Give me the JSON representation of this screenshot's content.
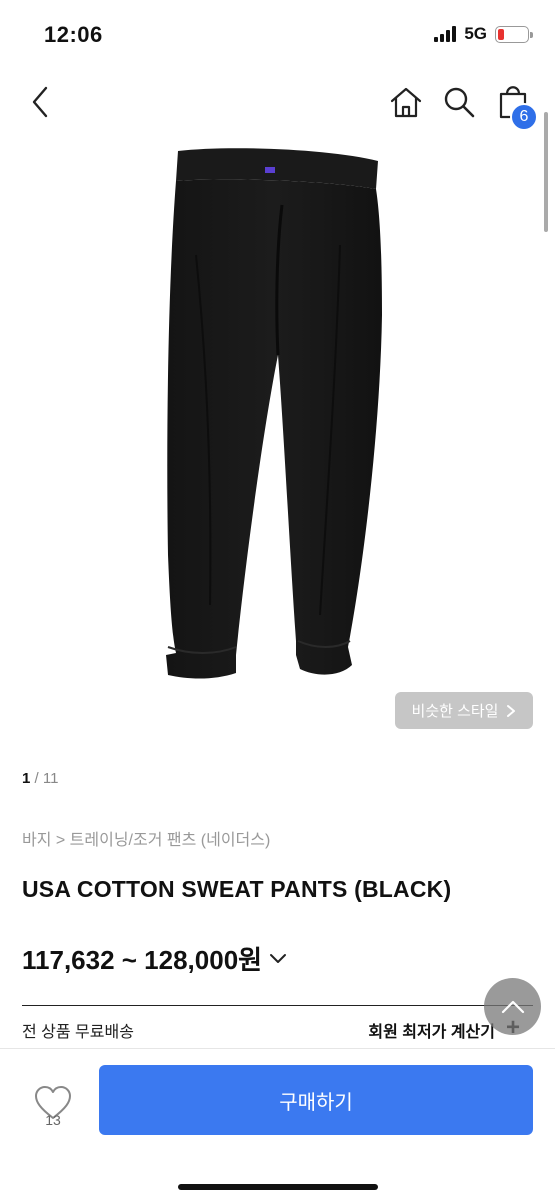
{
  "status": {
    "time": "12:06",
    "network": "5G"
  },
  "header": {
    "cart_count": "6"
  },
  "similar_style": {
    "label": "비슷한 스타일"
  },
  "pager": {
    "current": "1",
    "separator": " / ",
    "total": "11"
  },
  "breadcrumb": "바지 > 트레이닝/조거 팬츠 (네이더스)",
  "product": {
    "title": "USA COTTON SWEAT PANTS (BLACK)",
    "price_range": "117,632 ~ 128,000원"
  },
  "shipping": {
    "free_label": "전 상품 무료배송",
    "calc_label": "회원 최저가 계산기",
    "calc_icon": "+"
  },
  "bottom": {
    "like_count": "13",
    "buy_label": "구매하기"
  },
  "colors": {
    "accent": "#3b79f0",
    "badge": "#2f6fe8",
    "battery_low": "#e8322f"
  }
}
